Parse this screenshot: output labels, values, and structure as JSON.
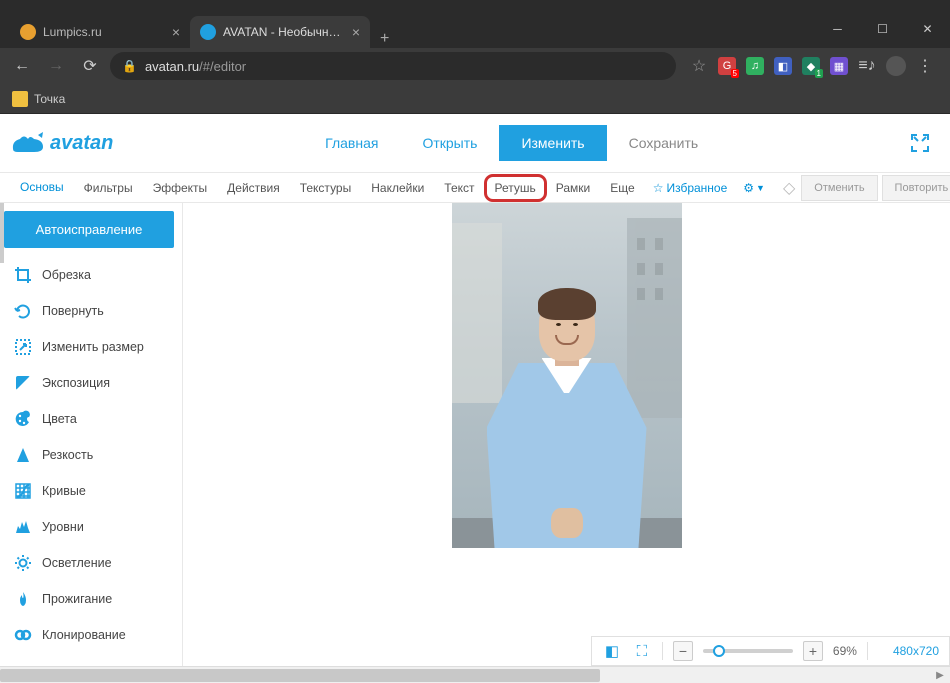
{
  "browser": {
    "tabs": [
      {
        "title": "Lumpics.ru",
        "favicon": "#e8a030"
      },
      {
        "title": "AVATAN - Необычный Фоторед..",
        "favicon": "#20a0e0"
      }
    ],
    "url_host": "avatan.ru",
    "url_path": "/#/editor",
    "bookmark": "Точка"
  },
  "header": {
    "logo": "avatan",
    "menu": {
      "home": "Главная",
      "open": "Открыть",
      "edit": "Изменить",
      "save": "Сохранить"
    }
  },
  "toolbar": {
    "tabs": [
      "Основы",
      "Фильтры",
      "Эффекты",
      "Действия",
      "Текстуры",
      "Наклейки",
      "Текст",
      "Ретушь",
      "Рамки",
      "Еще"
    ],
    "favorites": "Избранное",
    "undo": "Отменить",
    "redo": "Повторить"
  },
  "sidebar": {
    "auto": "Автоисправление",
    "items": [
      {
        "label": "Обрезка"
      },
      {
        "label": "Повернуть"
      },
      {
        "label": "Изменить размер"
      },
      {
        "label": "Экспозиция"
      },
      {
        "label": "Цвета"
      },
      {
        "label": "Резкость"
      },
      {
        "label": "Кривые"
      },
      {
        "label": "Уровни"
      },
      {
        "label": "Осветление"
      },
      {
        "label": "Прожигание"
      },
      {
        "label": "Клонирование"
      }
    ]
  },
  "zoom": {
    "percent": "69%",
    "dimensions": "480x720"
  }
}
